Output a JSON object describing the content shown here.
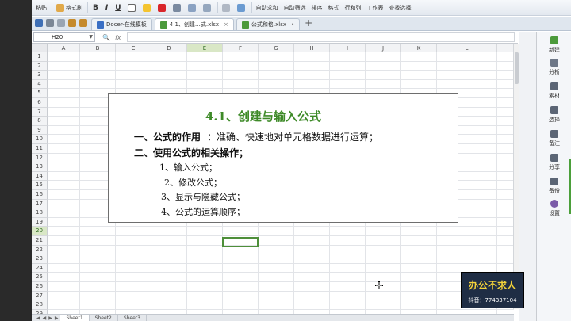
{
  "ribbon": {
    "paste": "粘贴",
    "format_painter": "格式刷",
    "bold": "B",
    "italic": "I",
    "underline": "U",
    "autosum": "自动求和",
    "autofilter": "自动筛选",
    "sort": "排序",
    "format": "格式",
    "rows_cols": "行和列",
    "worksheet": "工作表",
    "find_select": "查找选择"
  },
  "tabs": [
    {
      "label": "Docer-在线模板",
      "active": false
    },
    {
      "label": "4.1、创建…式.xlsx",
      "active": true
    },
    {
      "label": "公式和格.xlsx",
      "active": false
    }
  ],
  "formula_bar": {
    "name_box": "H20",
    "fx_symbol": "fx",
    "value": ""
  },
  "columns": [
    "A",
    "B",
    "C",
    "D",
    "E",
    "F",
    "G",
    "H",
    "I",
    "J",
    "K",
    "L"
  ],
  "rows": [
    "1",
    "2",
    "3",
    "4",
    "5",
    "6",
    "7",
    "8",
    "9",
    "10",
    "11",
    "12",
    "13",
    "14",
    "15",
    "16",
    "17",
    "18",
    "19",
    "20",
    "21",
    "22",
    "23",
    "24",
    "25",
    "26",
    "27",
    "28",
    "29"
  ],
  "slide": {
    "title": "4.1、创建与输入公式",
    "line1_a": "一、公式的作用",
    "line1_b": "：准确、快速地对单元格数据进行运算；",
    "line2": "二、使用公式的相关操作；",
    "items": [
      "1、输入公式；",
      "2、修改公式；",
      "3、显示与隐藏公式；",
      "4、公式的运算顺序；"
    ]
  },
  "right_panel": [
    "新建",
    "分析",
    "素材",
    "选择",
    "备注",
    "分享",
    "备份",
    "设置"
  ],
  "sheets": [
    "Sheet1",
    "Sheet2",
    "Sheet3"
  ],
  "watermark": {
    "line1": "办公不求人",
    "line2": "抖音：774337104"
  }
}
